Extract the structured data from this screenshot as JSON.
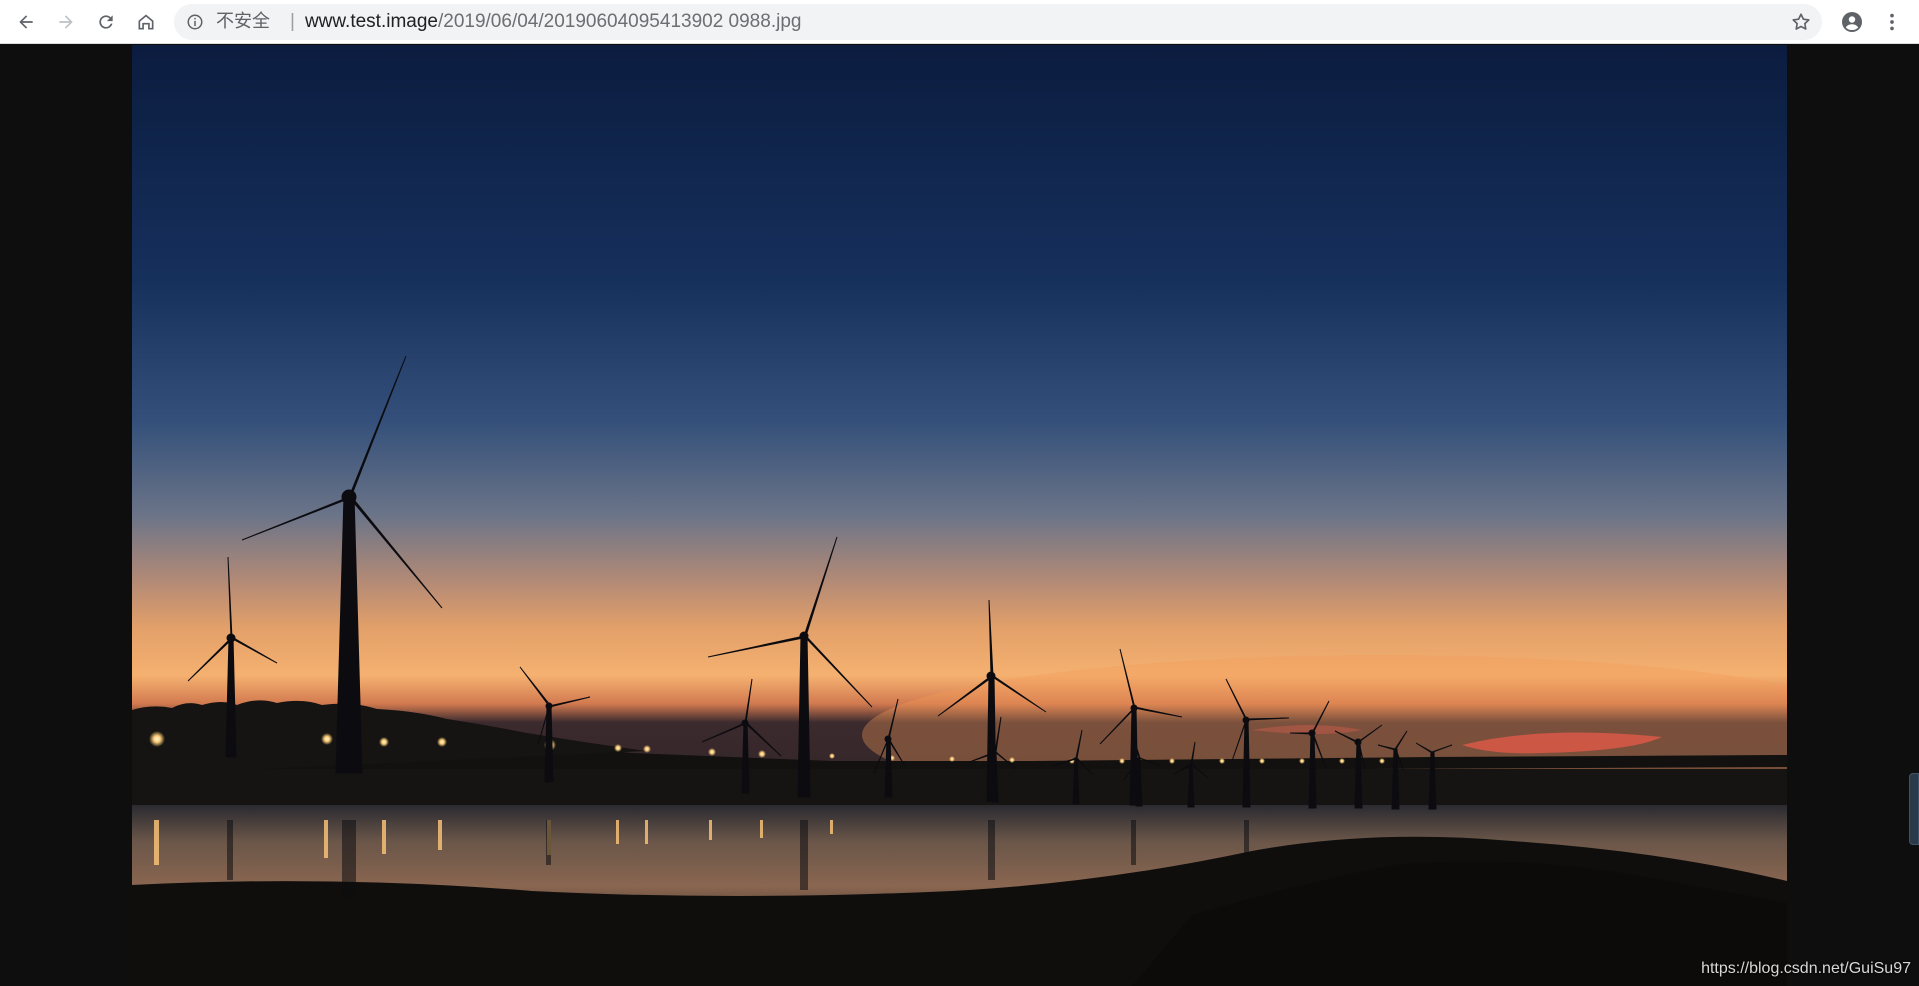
{
  "browser": {
    "security_label": "不安全",
    "url_host": "www.test.image",
    "url_path": "/2019/06/04/20190604095413902 0988.jpg"
  },
  "icons": {
    "back": "arrow-left-icon",
    "forward": "arrow-right-icon",
    "reload": "reload-icon",
    "home": "home-icon",
    "info": "info-icon",
    "star": "star-icon",
    "account": "account-icon",
    "menu": "menu-icon"
  },
  "page": {
    "watermark": "https://blog.csdn.net/GuiSu97"
  },
  "colors": {
    "toolbar_bg": "#ffffff",
    "omnibox_bg": "#f1f3f4",
    "page_bg": "#0e0e0e",
    "sky_top": "#0d2147",
    "sky_horizon": "#f2a35c"
  }
}
